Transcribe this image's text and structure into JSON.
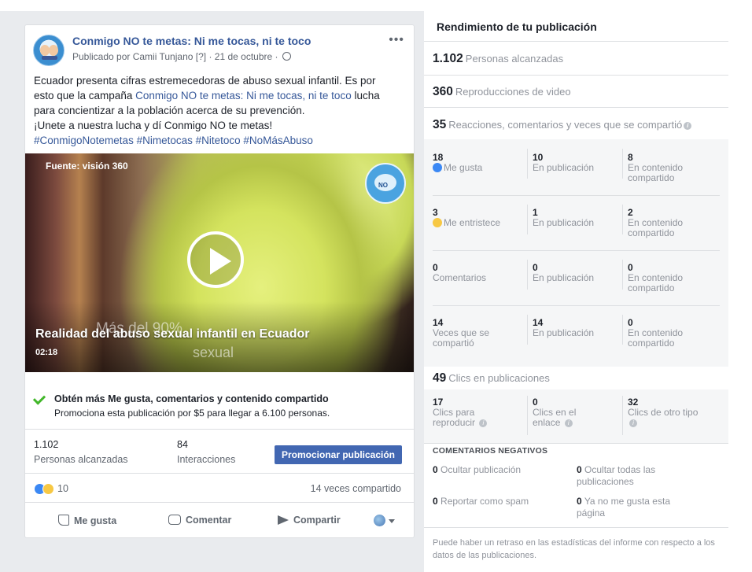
{
  "post": {
    "page_name": "Conmigo NO te metas: Ni me tocas, ni te toco",
    "published_prefix": "Publicado por Camii Tunjano",
    "published_tag": "[?]",
    "published_date": "· 21 de octubre ·",
    "more": "•••",
    "text": {
      "line1": "Ecuador presenta cifras estremecedoras de abuso sexual infantil. Es por",
      "line2_a": "esto que la campaña ",
      "line2_link": "Conmigo NO te metas: Ni me tocas, ni te toco",
      "line2_b": " lucha",
      "line3": "para concientizar a la población acerca de su prevención.",
      "line4": "¡Unete a nuestra lucha y dí Conmigo NO te metas!",
      "hashtags": "#ConmigoNotemetas #Nimetocas #Nitetoco #NoMásAbuso"
    },
    "video": {
      "source": "Fuente: visión 360",
      "title": "Realidad del abuso sexual infantil en Ecuador",
      "overlay_line1": "Más del 90%",
      "overlay_line2": "sexual",
      "duration": "02:18",
      "logo_text": "NO"
    },
    "promo": {
      "title": "Obtén más Me gusta, comentarios y contenido compartido",
      "subtitle": "Promociona esta publicación por $5 para llegar a 6.100 personas."
    },
    "stats": {
      "reach_value": "1.102",
      "reach_label": "Personas alcanzadas",
      "engagement_value": "84",
      "engagement_label": "Interacciones",
      "promote_button": "Promocionar publicación"
    },
    "reactions_count": "10",
    "shares": "14 veces compartido",
    "actions": {
      "like": "Me gusta",
      "comment": "Comentar",
      "share": "Compartir"
    }
  },
  "performance": {
    "title": "Rendimiento de tu publicación",
    "reach": {
      "value": "1.102",
      "label": "Personas alcanzadas"
    },
    "views": {
      "value": "360",
      "label": "Reproducciones de video"
    },
    "interactions": {
      "value": "35",
      "label": "Reacciones, comentarios y veces que se compartió"
    },
    "rows": [
      {
        "total": "18",
        "total_label": "Me gusta",
        "on_post": "10",
        "on_post_label": "En publicación",
        "shared": "8",
        "shared_label": "En contenido compartido"
      },
      {
        "total": "3",
        "total_label": "Me entristece",
        "on_post": "1",
        "on_post_label": "En publicación",
        "shared": "2",
        "shared_label": "En contenido compartido"
      },
      {
        "total": "0",
        "total_label": "Comentarios",
        "on_post": "0",
        "on_post_label": "En publicación",
        "shared": "0",
        "shared_label": "En contenido compartido"
      },
      {
        "total": "14",
        "total_label": "Veces que se compartió",
        "on_post": "14",
        "on_post_label": "En publicación",
        "shared": "0",
        "shared_label": "En contenido compartido"
      }
    ],
    "clicks": {
      "value": "49",
      "label": "Clics en publicaciones"
    },
    "click_rows": [
      {
        "value": "17",
        "label": "Clics para reproducir"
      },
      {
        "value": "0",
        "label": "Clics en el enlace"
      },
      {
        "value": "32",
        "label": "Clics de otro tipo"
      }
    ],
    "negative": {
      "title": "COMENTARIOS NEGATIVOS",
      "hide_post_value": "0",
      "hide_post_label": "Ocultar publicación",
      "hide_all_value": "0",
      "hide_all_label": "Ocultar todas las publicaciones",
      "spam_value": "0",
      "spam_label": "Reportar como spam",
      "unlike_value": "0",
      "unlike_label": "Ya no me gusta esta página"
    },
    "footnote": "Puede haber un retraso en las estadísticas del informe con respecto a los datos de las publicaciones."
  }
}
